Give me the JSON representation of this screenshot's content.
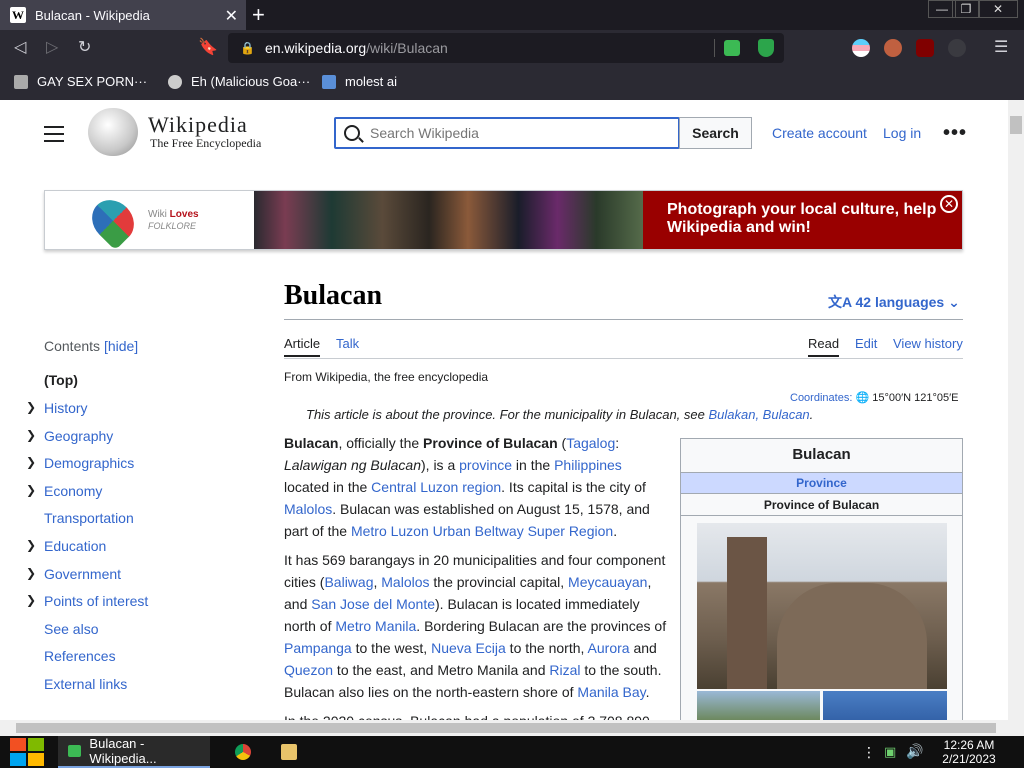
{
  "browser": {
    "tab_title": "Bulacan - Wikipedia",
    "tab_favicon": "W",
    "url_host": "en.wikipedia.org",
    "url_path": "/wiki/Bulacan",
    "bookmarks": [
      "GAY SEX PORN···",
      "Eh (Malicious Goa···",
      "molest ai"
    ]
  },
  "header": {
    "wordmark": "Wikipedia",
    "tagline": "The Free Encyclopedia",
    "search_placeholder": "Search Wikipedia",
    "search_button": "Search",
    "create_account": "Create account",
    "log_in": "Log in",
    "more": "•••"
  },
  "banner": {
    "logo_line1": "Wiki",
    "logo_line1_b": "Loves",
    "logo_line2": "FOLKLORE",
    "cta": "Photograph your local culture, help Wikipedia and win!",
    "close": "✕"
  },
  "article": {
    "title": "Bulacan",
    "languages": "42 languages",
    "tabs": [
      "Article",
      "Talk"
    ],
    "actions": [
      "Read",
      "Edit",
      "View history"
    ],
    "from": "From Wikipedia, the free encyclopedia",
    "coords_label": "Coordinates:",
    "coords_value": "15°00′N 121°05′E",
    "hatnote_text": "This article is about the province. For the municipality in Bulacan, see ",
    "hatnote_link": "Bulakan, Bulacan",
    "hatnote_end": "."
  },
  "toc": {
    "label": "Contents",
    "hide": "[hide]",
    "items": [
      "(Top)",
      "History",
      "Geography",
      "Demographics",
      "Economy",
      "Transportation",
      "Education",
      "Government",
      "Points of interest",
      "See also",
      "References",
      "External links"
    ]
  },
  "infobox": {
    "title": "Bulacan",
    "type": "Province",
    "name": "Province of Bulacan"
  },
  "taskbar": {
    "task_label": "Bulacan - Wikipedia...",
    "time": "12:26 AM",
    "date": "2/21/2023"
  }
}
